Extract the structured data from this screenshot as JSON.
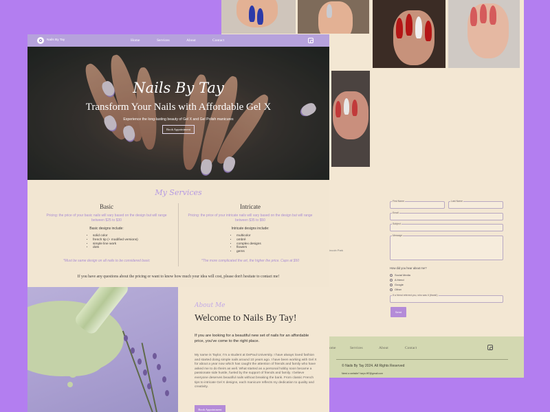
{
  "nav": {
    "brand": "Nails By Tay",
    "links": [
      "Home",
      "Services",
      "About",
      "Contact"
    ]
  },
  "hero": {
    "script_title": "Nails By Tay",
    "title": "Transform Your Nails with Affordable Gel X",
    "subtitle": "Experience the long-lasting beauty of Gel X and Gel Polish manicures",
    "button": "Book Appointment"
  },
  "services": {
    "heading": "My Services",
    "basic": {
      "title": "Basic",
      "pricing": "Pricing: the price of your basic nails will vary based on the design but will range between $25 to $30",
      "includes": "Basic designs include:",
      "items": [
        "solid color",
        "french tip (+ modified versions)",
        "simple line work",
        "dots"
      ],
      "note": "*Must be same design on all nails to be considered basic"
    },
    "intricate": {
      "title": "Intricate",
      "pricing": "Pricing: the price of your intricate nails will vary based on the design but will range between $35 to $50",
      "includes": "Intricate designs include:",
      "items": [
        "multicolor",
        "ombré",
        "complex designs",
        "flowers",
        "gems"
      ],
      "note": "*The more complicated the art, the higher the price. Caps at $50"
    },
    "footer": "If you have any questions about the pricing or want to know how much your idea will cost, please don't hesitate to contact me!"
  },
  "about": {
    "kicker": "About Me",
    "title": "Welcome to Nails By Tay!",
    "lead": "If you are looking for a beautiful new set of nails for an affordable price, you've come to the right place.",
    "body": "My name is Taylor, I'm a student at DePaul University. I have always loved fashion and started doing simple nails around 10 years ago. I have been working with Gel X for about a year now which has caught the attention of friends and family who have asked me to do theirs as well. What started as a personal hobby soon became a passionate side hustle, fueled by the support of friends and family. I believe everyone deserves beautiful nails without breaking the bank. From classic French tips to intricate Gel X designs, each manicure reflects my dedication to quality and creativity.",
    "button": "Book Appointment"
  },
  "contact_form": {
    "first_name": "First Name",
    "last_name": "Last Name",
    "email": "Email",
    "subject": "Subject",
    "message": "Message",
    "heard_label": "How did you hear about me?",
    "options": [
      "Social Media",
      "A friend",
      "Google",
      "Other"
    ],
    "referral": "If a friend referred you, who was it (thank!)",
    "send": "Send",
    "location": "Lincoln Park"
  },
  "back_footer": {
    "links": [
      "Home",
      "Services",
      "About",
      "Contact"
    ],
    "copyright": "© Nails By Tay 2024. All Rights Reserved",
    "site_note": "Need a website? taryn.fff7@gmail.com"
  },
  "colors": {
    "background": "#b37ef0",
    "nav": "#b6a2dc",
    "accent": "#b48bd8",
    "cream": "#f3e7d3",
    "footer": "#d3d8b1"
  }
}
